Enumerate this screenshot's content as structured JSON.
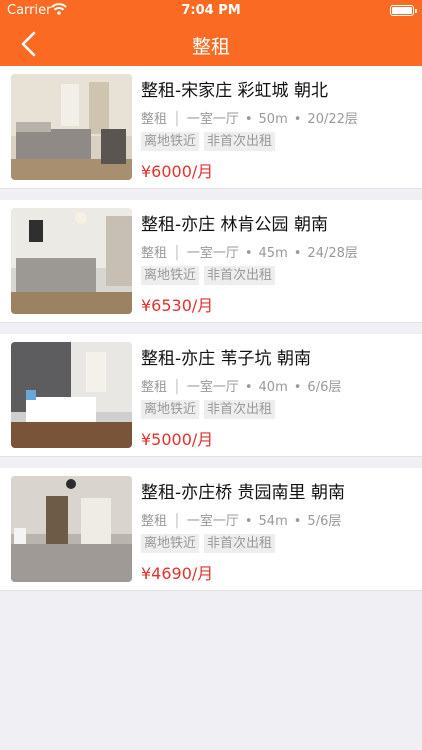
{
  "status_bar": {
    "carrier": "Carrier",
    "time": "7:04 PM"
  },
  "nav": {
    "title": "整租"
  },
  "listings": [
    {
      "title": "整租-宋家庄 彩虹城 朝北",
      "type": "整租",
      "layout": "一室一厅",
      "area": "50m",
      "floor": "20/22层",
      "tags": [
        "离地铁近",
        "非首次出租"
      ],
      "price": "¥6000/月"
    },
    {
      "title": "整租-亦庄 林肯公园 朝南",
      "type": "整租",
      "layout": "一室一厅",
      "area": "45m",
      "floor": "24/28层",
      "tags": [
        "离地铁近",
        "非首次出租"
      ],
      "price": "¥6530/月"
    },
    {
      "title": "整租-亦庄 苇子坑 朝南",
      "type": "整租",
      "layout": "一室一厅",
      "area": "40m",
      "floor": "6/6层",
      "tags": [
        "离地铁近",
        "非首次出租"
      ],
      "price": "¥5000/月"
    },
    {
      "title": "整租-亦庄桥 贵园南里 朝南",
      "type": "整租",
      "layout": "一室一厅",
      "area": "54m",
      "floor": "5/6层",
      "tags": [
        "离地铁近",
        "非首次出租"
      ],
      "price": "¥4690/月"
    }
  ],
  "colors": {
    "header": "#fa6a22",
    "price": "#e3322d",
    "background": "#efeff4"
  }
}
